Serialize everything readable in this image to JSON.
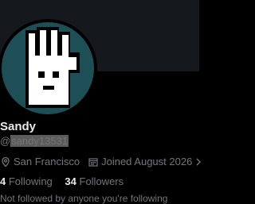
{
  "profile": {
    "display_name": "Sandy",
    "handle_prefix": "@",
    "handle_selected": "sandy13531",
    "avatar_icon": "pixel-hand-icon",
    "location": "San Francisco",
    "joined": "Joined August 2026",
    "following_count": "4",
    "following_label": "Following",
    "followers_count": "34",
    "followers_label": "Followers",
    "note": "Not followed by anyone you're following"
  },
  "colors": {
    "background": "#000000",
    "banner": "#15181c",
    "avatar_bg": "#1e4e56",
    "text_primary": "#e7e9ea",
    "text_secondary": "#71767b"
  }
}
